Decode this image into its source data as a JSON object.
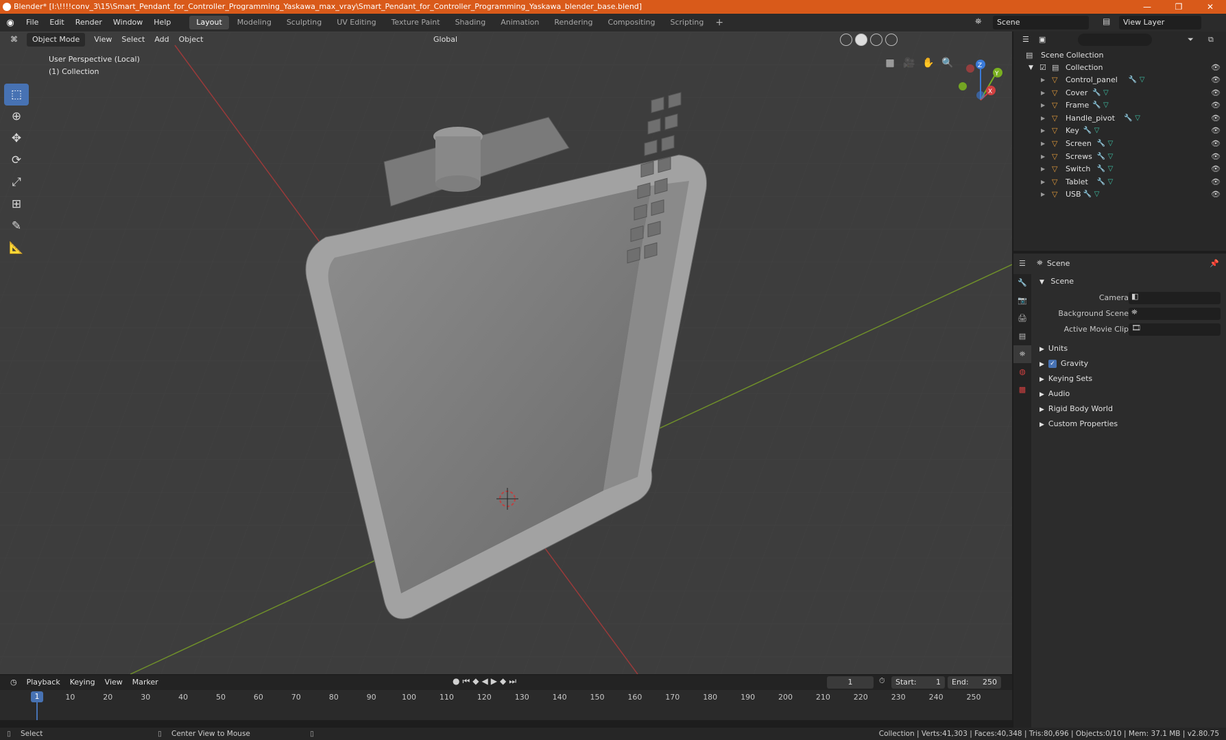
{
  "window": {
    "title": "Blender* [I:\\!!!!conv_3\\15\\Smart_Pendant_for_Controller_Programming_Yaskawa_max_vray\\Smart_Pendant_for_Controller_Programming_Yaskawa_blender_base.blend]",
    "minimize": "—",
    "restore": "❐",
    "close": "✕"
  },
  "menubar": {
    "items": [
      "File",
      "Edit",
      "Render",
      "Window",
      "Help"
    ]
  },
  "workspaces": {
    "tabs": [
      "Layout",
      "Modeling",
      "Sculpting",
      "UV Editing",
      "Texture Paint",
      "Shading",
      "Animation",
      "Rendering",
      "Compositing",
      "Scripting"
    ],
    "active": "Layout",
    "add": "+"
  },
  "scene_selector": {
    "scene": "Scene",
    "view_layer": "View Layer"
  },
  "viewport": {
    "mode": "Object Mode",
    "menus": [
      "View",
      "Select",
      "Add",
      "Object"
    ],
    "orientation": "Global",
    "info_line1": "User Perspective (Local)",
    "info_line2": "(1) Collection",
    "gizmo": {
      "x": "X",
      "y": "Y",
      "z": "Z"
    }
  },
  "outliner": {
    "root": "Scene Collection",
    "collection": "Collection",
    "objects": [
      "Control_panel",
      "Cover",
      "Frame",
      "Handle_pivot",
      "Key",
      "Screen",
      "Screws",
      "Switch",
      "Tablet",
      "USB"
    ]
  },
  "properties": {
    "header": "Scene",
    "panel_title": "Scene",
    "fields": {
      "camera_label": "Camera",
      "background_scene_label": "Background Scene",
      "active_movie_clip_label": "Active Movie Clip"
    },
    "subpanels": [
      "Units",
      "Gravity",
      "Keying Sets",
      "Audio",
      "Rigid Body World",
      "Custom Properties"
    ],
    "gravity_checked": true
  },
  "timeline": {
    "menus": [
      "Playback",
      "Keying",
      "View",
      "Marker"
    ],
    "current_frame": "1",
    "start_label": "Start:",
    "start": "1",
    "end_label": "End:",
    "end": "250",
    "ticks": [
      "1",
      "10",
      "20",
      "30",
      "40",
      "50",
      "60",
      "70",
      "80",
      "90",
      "100",
      "110",
      "120",
      "130",
      "140",
      "150",
      "160",
      "170",
      "180",
      "190",
      "200",
      "210",
      "220",
      "230",
      "240",
      "250"
    ]
  },
  "statusbar": {
    "left": "Select",
    "middle": "Center View to Mouse",
    "right": "Collection | Verts:41,303 | Faces:40,348 | Tris:80,696 | Objects:0/10 | Mem: 37.1 MB | v2.80.75"
  },
  "colors": {
    "title_bar": "#d95a1a",
    "accent": "#4772b3",
    "viewport_bg": "#3d3d3d",
    "object_icon": "#e39b3b",
    "mesh_icon": "#3ec2a6",
    "axis_x": "#d04040",
    "axis_y": "#7ab020",
    "axis_z": "#3a7ad8"
  }
}
